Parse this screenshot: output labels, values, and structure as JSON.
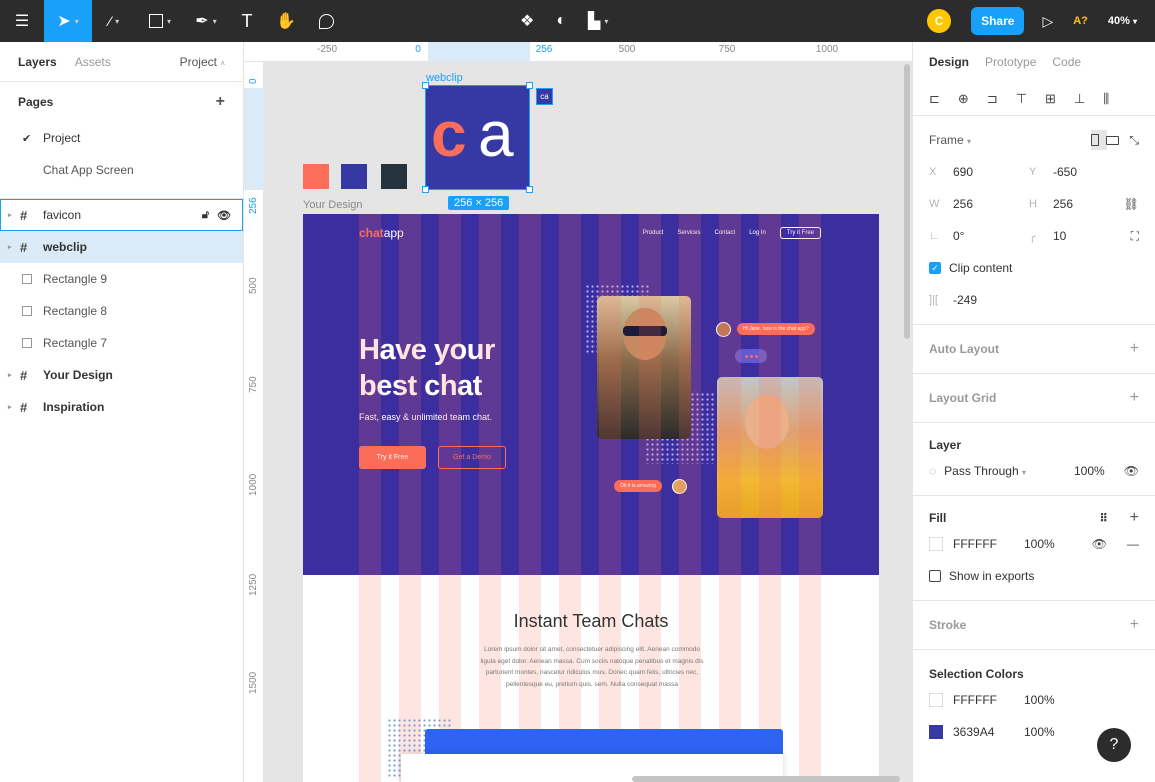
{
  "toolbar": {
    "zoom": "40%",
    "share_label": "Share",
    "avatar_initial": "C",
    "a11y_label": "A?"
  },
  "left_panel": {
    "tabs": [
      "Layers",
      "Assets"
    ],
    "project_label": "Project",
    "pages_title": "Pages",
    "pages": [
      "Project",
      "Chat App Screen"
    ],
    "layers": [
      {
        "name": "favicon",
        "type": "frame"
      },
      {
        "name": "webclip",
        "type": "frame"
      },
      {
        "name": "Rectangle 9",
        "type": "rect"
      },
      {
        "name": "Rectangle 8",
        "type": "rect"
      },
      {
        "name": "Rectangle 7",
        "type": "rect"
      },
      {
        "name": "Your Design",
        "type": "frame"
      },
      {
        "name": "Inspiration",
        "type": "frame"
      }
    ]
  },
  "ruler": {
    "top": [
      "-250",
      "0",
      "256",
      "500",
      "750",
      "1000"
    ],
    "left": [
      "0",
      "256",
      "500",
      "750",
      "1000",
      "1250",
      "1500"
    ]
  },
  "canvas": {
    "webclip_label": "webclip",
    "logo_c": "c",
    "logo_a": "a",
    "favicon_text": "ca",
    "size_badge": "256 × 256",
    "design_label": "Your Design",
    "swatches": [
      "#fc6d5a",
      "#3639a4",
      "#25333f"
    ]
  },
  "mock": {
    "logo_bold": "chat",
    "logo_rest": "app",
    "nav": [
      "Product",
      "Services",
      "Contact",
      "Log In"
    ],
    "nav_cta": "Try it Free",
    "hero_title_1": "Have your",
    "hero_title_2": "best chat",
    "hero_sub": "Fast, easy & unlimited team chat.",
    "btn_primary": "Try it Free",
    "btn_outline": "Get a Demo",
    "bubble_1": "Hi Jane, how is the chat app?",
    "bubble_2": "Oh it is amazing",
    "section_title": "Instant Team Chats",
    "section_body": "Lorem ipsum dolor sit amet, consectetuer adipiscing elit. Aenean commodo ligula eget dolor. Aenean massa. Cum sociis natoque penatibus et magnis dis parturient montes, nascetur ridiculus mus. Donec quam felis, ultricies nec, pellentesque eu, pretium quis, sem. Nulla consequat massa"
  },
  "right_panel": {
    "tabs": [
      "Design",
      "Prototype",
      "Code"
    ],
    "frame_label": "Frame",
    "x": "690",
    "y": "-650",
    "w": "256",
    "h": "256",
    "rotation": "0°",
    "radius": "10",
    "clip_content": "Clip content",
    "spacing": "-249",
    "auto_layout": "Auto Layout",
    "layout_grid": "Layout Grid",
    "layer_title": "Layer",
    "blend": "Pass Through",
    "layer_opacity": "100%",
    "fill_title": "Fill",
    "fill_hex": "FFFFFF",
    "fill_opacity": "100%",
    "show_exports": "Show in exports",
    "stroke": "Stroke",
    "selection_colors": "Selection Colors",
    "sel_colors": [
      {
        "hex": "FFFFFF",
        "opacity": "100%",
        "color": "#ffffff"
      },
      {
        "hex": "3639A4",
        "opacity": "100%",
        "color": "#3639a4"
      }
    ]
  }
}
